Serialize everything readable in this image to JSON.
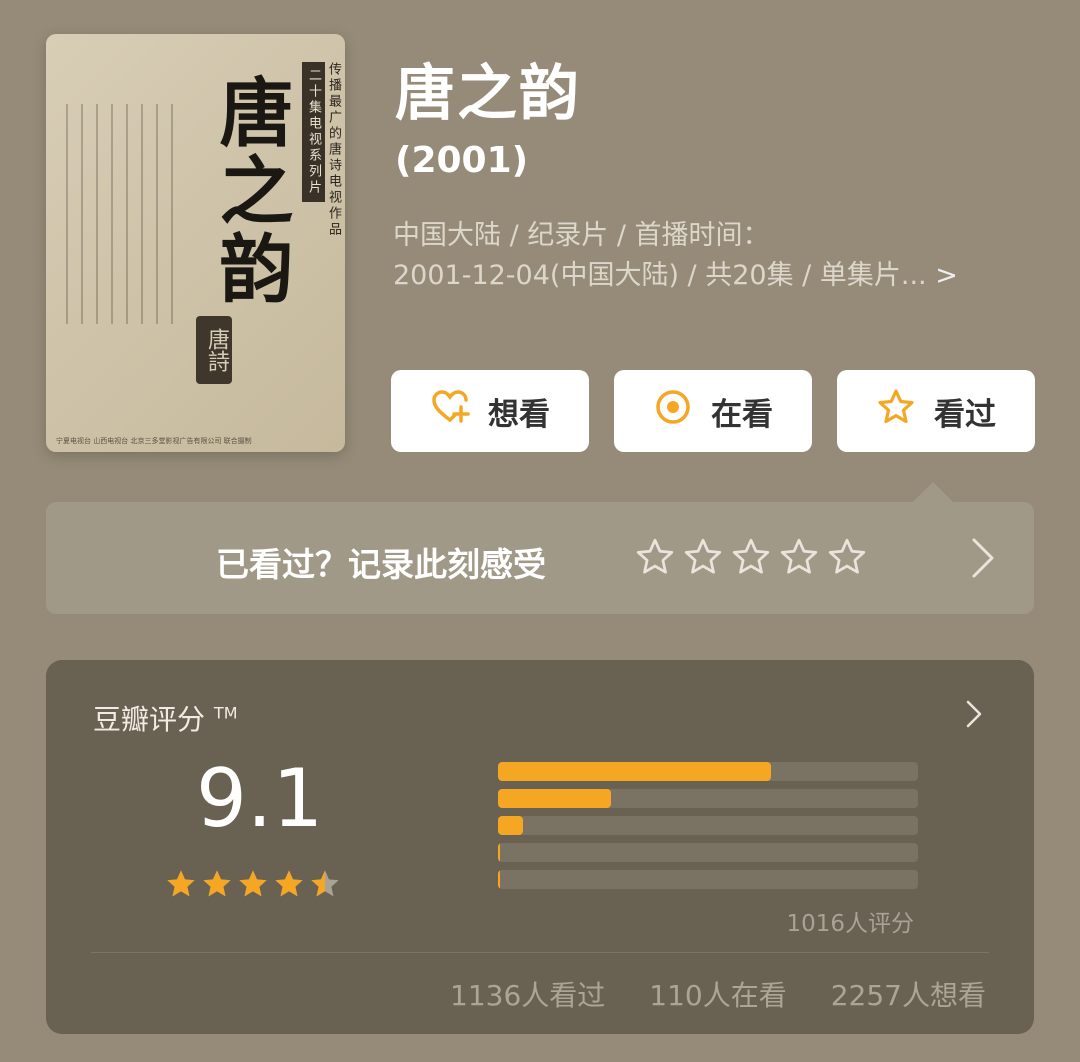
{
  "movie": {
    "title": "唐之韵",
    "year": "(2001)",
    "meta_line1": "中国大陆 / 纪录片 / 首播时间：",
    "meta_line2": "2001-12-04(中国大陆) / 共20集 / 单集片...",
    "meta_more": ">"
  },
  "poster": {
    "big_text": "唐之韵",
    "subtitle1": "传播最广的唐诗电视作品",
    "subtitle2": "二十集电视系列片",
    "seal_text": "唐詩",
    "footer": "宁夏电视台    山西电视台    北京三多堂影视广告有限公司    联合摄制"
  },
  "actions": {
    "want_label": "想看",
    "watching_label": "在看",
    "watched_label": "看过"
  },
  "rate_prompt": {
    "text": "已看过？记录此刻感受"
  },
  "rating": {
    "label": "豆瓣评分",
    "tm": "TM",
    "score": "9.1",
    "star_level": 4.5,
    "distribution": [
      {
        "stars": 5,
        "fraction": 0.65
      },
      {
        "stars": 4,
        "fraction": 0.27
      },
      {
        "stars": 3,
        "fraction": 0.06
      },
      {
        "stars": 2,
        "fraction": 0.005
      },
      {
        "stars": 1,
        "fraction": 0.003
      }
    ],
    "rated_count": "1016人评分",
    "watched_count": "1136人看过",
    "watching_count": "110人在看",
    "want_count": "2257人想看"
  },
  "colors": {
    "background": "#958b78",
    "accent": "#f5a623",
    "card": "#696151"
  }
}
